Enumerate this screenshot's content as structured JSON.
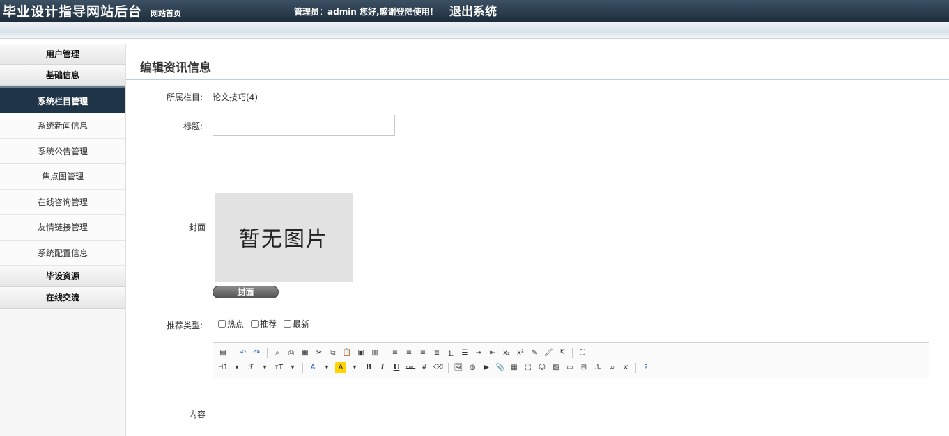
{
  "header": {
    "site_title": "毕业设计指导网站后台",
    "home_link": "网站首页",
    "welcome": "管理员：admin 您好,感谢登陆使用！",
    "logout": "退出系统"
  },
  "sidebar": {
    "user_mgmt": "用户管理",
    "basic_info": "基础信息",
    "active_item": "系统栏目管理",
    "items": [
      "系统新闻信息",
      "系统公告管理",
      "焦点图管理",
      "在线咨询管理",
      "友情链接管理",
      "系统配置信息"
    ],
    "resources": "毕设资源",
    "online_chat": "在线交流"
  },
  "main": {
    "page_title": "编辑资讯信息",
    "column_label": "所属栏目:",
    "column_value": "论文技巧(4)",
    "title_label": "标题:",
    "title_value": "",
    "cover_label": "封面",
    "cover_placeholder": "暂无图片",
    "cover_button": "封面",
    "recommend_label": "推荐类型:",
    "checks": [
      "热点",
      "推荐",
      "最新"
    ],
    "content_label": "内容"
  },
  "editor": {
    "heading_btn": "H1",
    "font_btn": "ℱ",
    "size_btn": "тT",
    "font_color_btn": "A",
    "bg_color_btn": "A",
    "bold_btn": "B",
    "italic_btn": "I",
    "underline_btn": "U",
    "strike_btn": "ABC",
    "sub_btn": "x₂",
    "sup_btn": "x²"
  }
}
